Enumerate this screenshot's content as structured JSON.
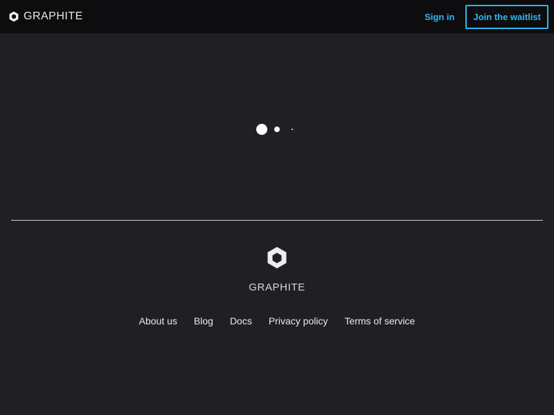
{
  "header": {
    "brand": {
      "icon": "graphite-hexagon-icon",
      "text": "GRAPHITE"
    },
    "sign_in_label": "Sign in",
    "waitlist_label": "Join the waitlist",
    "accent_color": "#2fb8f0"
  },
  "main": {
    "loading_indicator": {
      "dots": 3
    }
  },
  "footer": {
    "brand": {
      "icon": "graphite-hexagon-icon",
      "text": "GRAPHITE"
    },
    "links": [
      "About us",
      "Blog",
      "Docs",
      "Privacy policy",
      "Terms of service"
    ]
  },
  "colors": {
    "background": "#1f1f24",
    "topbar": "#0d0d0f"
  }
}
